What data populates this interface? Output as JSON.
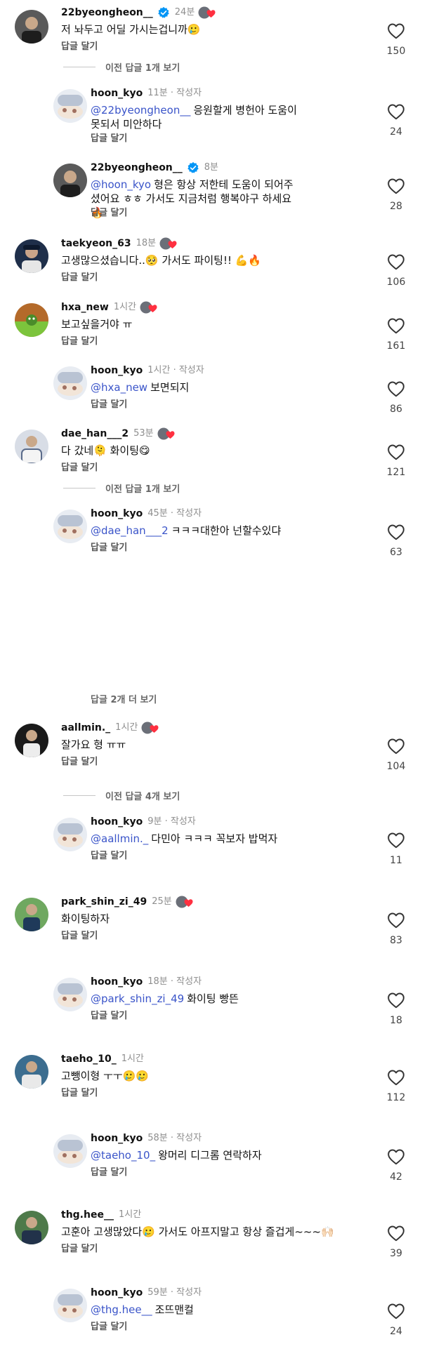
{
  "comments": [
    {
      "username": "22byeongheon__",
      "time": "24분",
      "verified": true,
      "badge": true,
      "text": "저 놔두고 어딜 가시는겁니까🥲",
      "reply": "답글 달기",
      "likes": "150"
    },
    {
      "username": "hoon_kyo",
      "time": "11분",
      "author": "작성자",
      "mention": "@22byeongheon__",
      "text": "응원할게 병헌아 도움이 못되서 미안하다",
      "reply": "답글 달기",
      "likes": "24"
    },
    {
      "username": "22byeongheon__",
      "time": "8분",
      "verified": true,
      "mention": "@hoon_kyo",
      "text": "형은 항상 저한테 도움이 되어주셨어요 ㅎㅎ 가서도 지금처럼 행복야구 하세요🔥",
      "reply": "답글 달기",
      "likes": "28"
    },
    {
      "username": "taekyeon_63",
      "time": "18분",
      "badge": true,
      "text": "고생많으셨습니다..🥺 가서도 파이팅!! 💪🔥",
      "reply": "답글 달기",
      "likes": "106"
    },
    {
      "username": "hxa_new",
      "time": "1시간",
      "badge": true,
      "text": "보고싶을거야 ㅠ",
      "reply": "답글 달기",
      "likes": "161"
    },
    {
      "username": "hoon_kyo",
      "time": "1시간",
      "author": "작성자",
      "mention": "@hxa_new",
      "text": "보면되지",
      "reply": "답글 달기",
      "likes": "86"
    },
    {
      "username": "dae_han___2",
      "time": "53분",
      "badge": true,
      "text": "다 갔네🫠 화이팅😋",
      "reply": "답글 달기",
      "likes": "121"
    },
    {
      "username": "hoon_kyo",
      "time": "45분",
      "author": "작성자",
      "mention": "@dae_han___2",
      "text": "ㅋㅋㅋ대한아 넌할수있댜",
      "reply": "답글 달기",
      "likes": "63"
    },
    {
      "username": "aallmin._",
      "time": "1시간",
      "badge": true,
      "text": "잘가요 형 ㅠㅠ",
      "reply": "답글 달기",
      "likes": "104"
    },
    {
      "username": "hoon_kyo",
      "time": "9분",
      "author": "작성자",
      "mention": "@aallmin._",
      "text": "다민아 ㅋㅋㅋ 꼭보자 밥먹자",
      "reply": "답글 달기",
      "likes": "11"
    },
    {
      "username": "park_shin_zi_49",
      "time": "25분",
      "badge": true,
      "text": "화이팅하자",
      "reply": "답글 달기",
      "likes": "83"
    },
    {
      "username": "hoon_kyo",
      "time": "18분",
      "author": "작성자",
      "mention": "@park_shin_zi_49",
      "text": "화이팅 빵뜬",
      "reply": "답글 달기",
      "likes": "18"
    },
    {
      "username": "taeho_10_",
      "time": "1시간",
      "text": "고뺑이형 ㅜㅜ🥲🥲",
      "reply": "답글 달기",
      "likes": "112"
    },
    {
      "username": "hoon_kyo",
      "time": "58분",
      "author": "작성자",
      "mention": "@taeho_10_",
      "text": "왕머리 디그롬 연락하자",
      "reply": "답글 달기",
      "likes": "42"
    },
    {
      "username": "thg.hee__",
      "time": "1시간",
      "text": "고훈아 고생많았다🥲 가서도 아프지말고 항상 즐겁게~~~🙌🏻",
      "reply": "답글 달기",
      "likes": "39"
    },
    {
      "username": "hoon_kyo",
      "time": "59분",
      "author": "작성자",
      "mention": "@thg.hee__",
      "text": "조뜨맨컬",
      "reply": "답글 달기",
      "likes": "24"
    }
  ],
  "expanders": {
    "e1": "이전 답글 1개 보기",
    "e2": "이전 답글 1개 보기",
    "e3": "답글 2개 더 보기",
    "e4": "이전 답글 4개 보기"
  },
  "colors": {
    "mention": "#3a54c9",
    "verified": "#0095f6",
    "badge_heart": "#ff3040"
  }
}
